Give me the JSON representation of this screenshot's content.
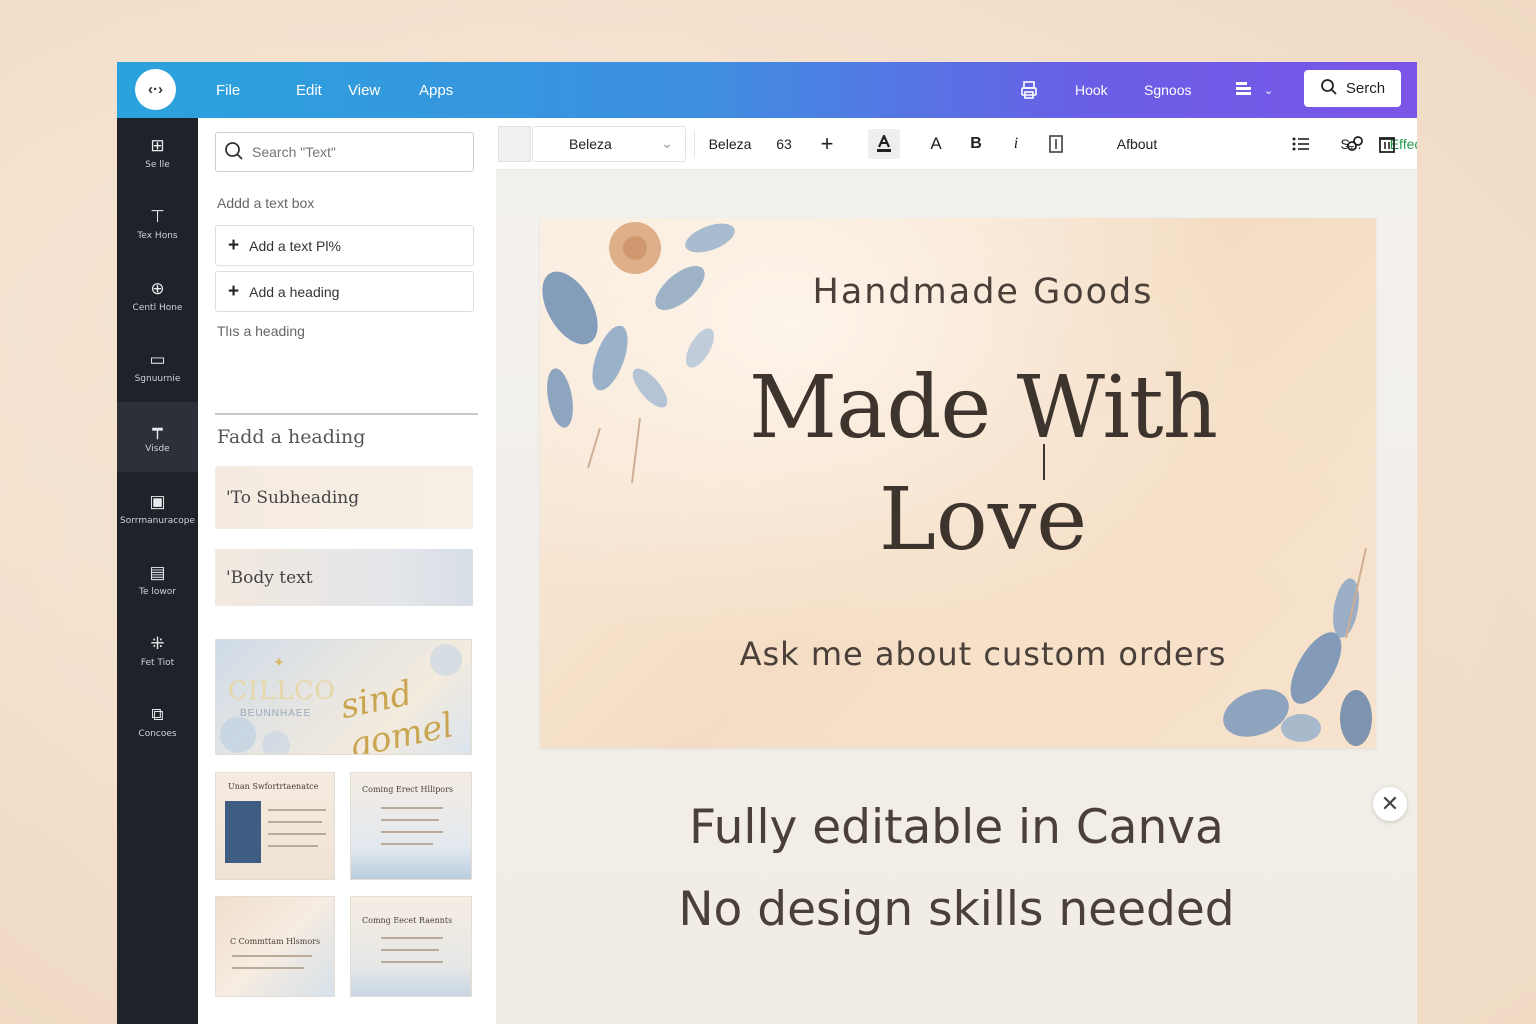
{
  "topbar": {
    "menu": [
      "File",
      "Edit",
      "View",
      "Apps"
    ],
    "right_items": [
      "Hook",
      "Sgnoos"
    ],
    "search_label": "Serch"
  },
  "rail": {
    "items": [
      {
        "label": "Se lle",
        "icon": "grid-icon"
      },
      {
        "label": "Tex Hons",
        "icon": "text-icon"
      },
      {
        "label": "Centl Hone",
        "icon": "shapes-icon"
      },
      {
        "label": "Sgnuurnie",
        "icon": "document-icon"
      },
      {
        "label": "Visde",
        "icon": "brush-icon"
      },
      {
        "label": "Sorrmanuracope",
        "icon": "image-icon"
      },
      {
        "label": "Te lowor",
        "icon": "frame-icon"
      },
      {
        "label": "Fet Tiot",
        "icon": "apps-icon"
      },
      {
        "label": "Concoes",
        "icon": "layers-icon"
      }
    ]
  },
  "panel": {
    "search_placeholder": "Search \"Text\"",
    "add_text_box_label": "Addd a text box",
    "add_text_button": "Add a text Pl%",
    "add_heading_button": "Add a heading",
    "this_heading_label": "Tlıs a heading",
    "fadd_heading": "Fadd a heading",
    "subheading_card": "'To Subheading",
    "body_card": "'Body text",
    "template_banner": {
      "left_big": "CILLCO",
      "left_small": "BEUNNHAEE",
      "right": "sind gomel"
    },
    "templates": [
      "Unan Swfortrtaenatce",
      "Coming Erect Hllipors",
      "C Commttam Hlsmors",
      "Comng Eecet Raennts"
    ]
  },
  "toolbar": {
    "font_dropdown": "Beleza",
    "font_name": "Beleza",
    "font_size": "63",
    "plus": "+",
    "bold": "B",
    "italic": "i",
    "letter_a": "A",
    "afbout": "Afbout",
    "spacing": "S̶...",
    "effects": "Effects"
  },
  "canvas": {
    "top_line": "Handmade Goods",
    "main_line1": "Made With",
    "main_line2": "Love",
    "sub_line": "Ask me about custom orders",
    "caption1": "Fully editable in Canva",
    "caption2": "No design skills needed"
  },
  "colors": {
    "topbar_start": "#2aa3dc",
    "topbar_end": "#7b55e8",
    "rail_bg": "#1e2229",
    "effects_green": "#1f9a4a",
    "card_text": "#3d342d"
  }
}
